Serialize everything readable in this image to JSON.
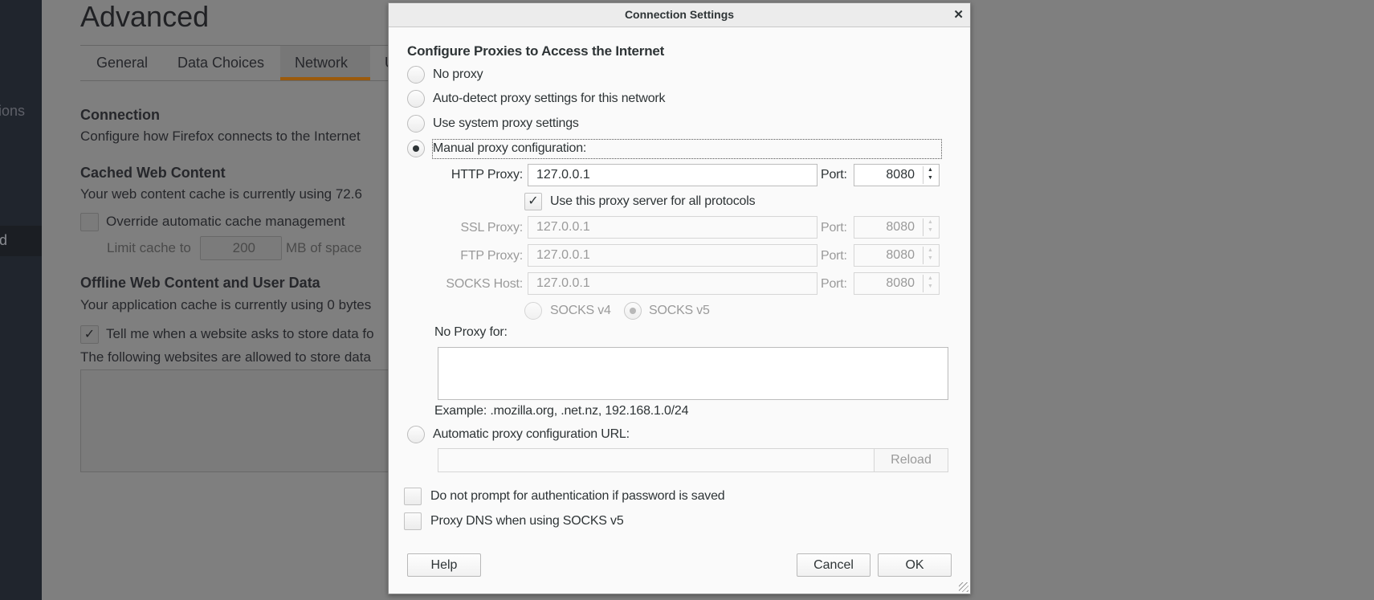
{
  "sidebar": {
    "items": [
      {
        "label": "ions"
      },
      {
        "label": "d",
        "selected": true
      }
    ]
  },
  "page": {
    "title": "Advanced",
    "tabs": [
      {
        "label": "General"
      },
      {
        "label": "Data Choices"
      },
      {
        "label": "Network",
        "active": true
      },
      {
        "label": "U"
      }
    ],
    "connection": {
      "heading": "Connection",
      "desc": "Configure how Firefox connects to the Internet"
    },
    "cache": {
      "heading": "Cached Web Content",
      "desc": "Your web content cache is currently using 72.6",
      "override_label": "Override automatic cache management",
      "override_checked": false,
      "limit_label": "Limit cache to",
      "limit_value": "200",
      "limit_unit": "MB of space"
    },
    "offline": {
      "heading": "Offline Web Content and User Data",
      "desc": "Your application cache is currently using 0 bytes",
      "tell_label": "Tell me when a website asks to store data fo",
      "tell_checked": true,
      "allowed_label": "The following websites are allowed to store data"
    }
  },
  "dialog": {
    "title": "Connection Settings",
    "close_icon": "close-icon",
    "heading": "Configure Proxies to Access the Internet",
    "options": [
      {
        "label": "No proxy",
        "checked": false
      },
      {
        "label": "Auto-detect proxy settings for this network",
        "checked": false
      },
      {
        "label": "Use system proxy settings",
        "checked": false
      },
      {
        "label": "Manual proxy configuration:",
        "checked": true
      }
    ],
    "http": {
      "label": "HTTP Proxy:",
      "value": "127.0.0.1",
      "port_label": "Port:",
      "port": "8080"
    },
    "all_protocols": {
      "label": "Use this proxy server for all protocols",
      "checked": true
    },
    "ssl": {
      "label": "SSL Proxy:",
      "value": "127.0.0.1",
      "port_label": "Port:",
      "port": "8080"
    },
    "ftp": {
      "label": "FTP Proxy:",
      "value": "127.0.0.1",
      "port_label": "Port:",
      "port": "8080"
    },
    "socks": {
      "label": "SOCKS Host:",
      "value": "127.0.0.1",
      "port_label": "Port:",
      "port": "8080"
    },
    "socks_v4": "SOCKS v4",
    "socks_v5": "SOCKS v5",
    "no_proxy_label": "No Proxy for:",
    "no_proxy_value": "",
    "example": "Example: .mozilla.org, .net.nz, 192.168.1.0/24",
    "auto_url_label": "Automatic proxy configuration URL:",
    "auto_url_value": "",
    "reload": "Reload",
    "no_prompt": {
      "label": "Do not prompt for authentication if password is saved",
      "checked": false
    },
    "proxy_dns": {
      "label": "Proxy DNS when using SOCKS v5",
      "checked": false
    },
    "help": "Help",
    "cancel": "Cancel",
    "ok": "OK"
  }
}
